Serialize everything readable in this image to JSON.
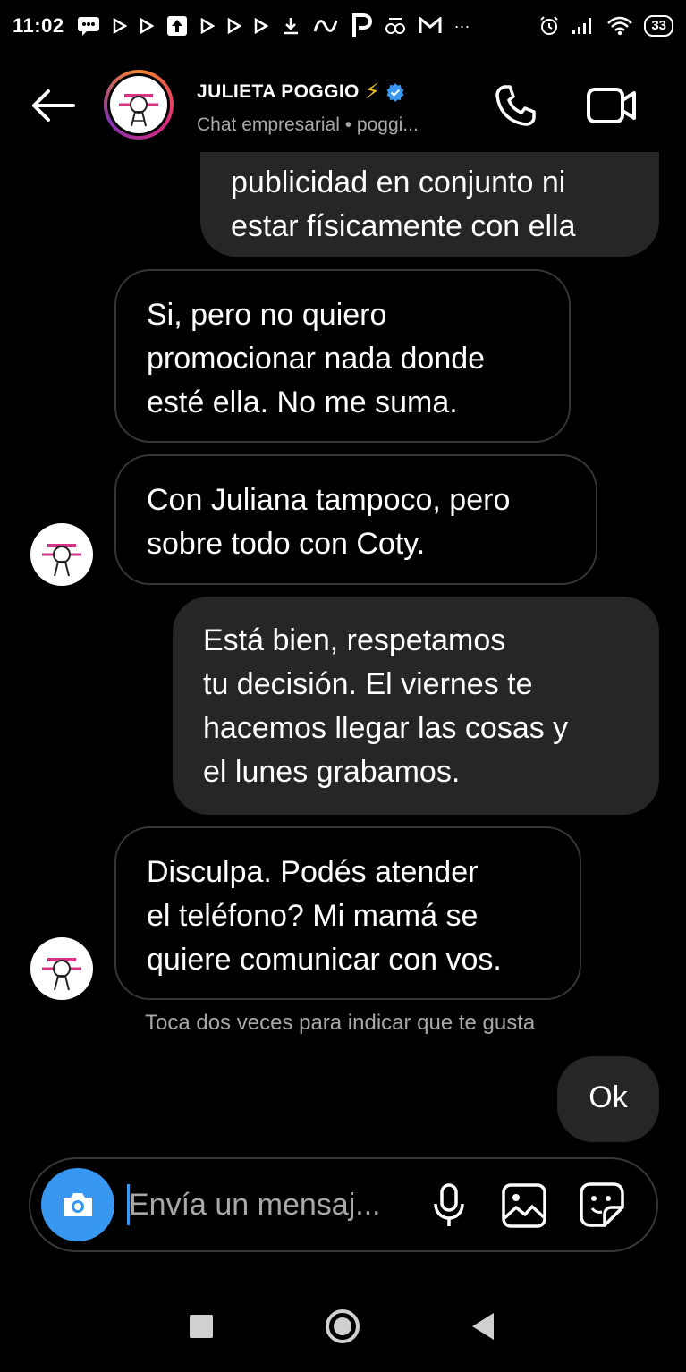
{
  "status_bar": {
    "time": "11:02",
    "notification_icons": [
      "sms-icon",
      "play-icon",
      "play-icon",
      "upload-icon",
      "play-icon",
      "play-icon",
      "play-icon",
      "download-icon",
      "app-icon",
      "paypal-icon",
      "app-icon",
      "gmail-icon",
      "more-icon"
    ],
    "more": "···",
    "battery": "33"
  },
  "header": {
    "name": "JULIETA POGGIO",
    "bolt": "⚡",
    "subtitle": "Chat empresarial • poggi..."
  },
  "messages": [
    {
      "direction": "out",
      "text": "publicidad en conjunto ni\nestar físicamente con ella"
    },
    {
      "direction": "in",
      "text": "Si, pero no quiero\npromocionar nada donde\nesté ella. No me suma."
    },
    {
      "direction": "in",
      "text": "Con Juliana tampoco, pero\nsobre todo con Coty."
    },
    {
      "direction": "out",
      "text": "Está bien, respetamos\ntu decisión. El viernes te\nhacemos llegar las cosas y\nel lunes grabamos."
    },
    {
      "direction": "in",
      "text": "Disculpa. Podés atender\nel teléfono? Mi mamá se\nquiere comunicar con vos."
    },
    {
      "direction": "out",
      "text": "Ok"
    }
  ],
  "like_hint": "Toca dos veces para indicar que te gusta",
  "composer": {
    "placeholder": "Envía un mensaj..."
  },
  "colors": {
    "background": "#000000",
    "outgoing_bubble": "#262626",
    "incoming_border": "#363636",
    "accent_blue": "#3897f0",
    "secondary_text": "#a8a8a8"
  }
}
